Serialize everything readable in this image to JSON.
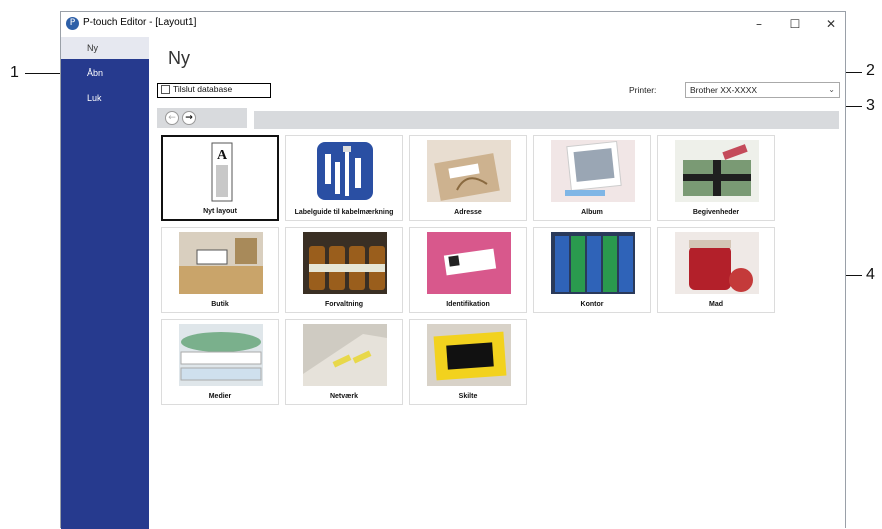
{
  "window": {
    "title": "P-touch Editor - [Layout1]",
    "controls": {
      "minimize": "–",
      "maximize": "☐",
      "close": "✕"
    }
  },
  "sidebar": {
    "items": [
      {
        "label": "Ny",
        "active": true
      },
      {
        "label": "Åbn",
        "active": false
      },
      {
        "label": "Luk",
        "active": false
      }
    ]
  },
  "main": {
    "title": "Ny",
    "connect_database_label": "Tilslut database",
    "connect_database_checked": false,
    "printer_label": "Printer:",
    "printer_value": "Brother XX-XXXX"
  },
  "nav": {
    "back": "←",
    "forward": "→"
  },
  "templates": [
    {
      "label": "Nyt layout",
      "selected": true
    },
    {
      "label": "Labelguide til kabelmærkning"
    },
    {
      "label": "Adresse"
    },
    {
      "label": "Album"
    },
    {
      "label": "Begivenheder"
    },
    {
      "label": "Butik"
    },
    {
      "label": "Forvaltning"
    },
    {
      "label": "Identifikation"
    },
    {
      "label": "Kontor"
    },
    {
      "label": "Mad"
    },
    {
      "label": "Medier"
    },
    {
      "label": "Netværk"
    },
    {
      "label": "Skilte"
    }
  ],
  "callouts": {
    "c1": "1",
    "c2": "2",
    "c3": "3",
    "c4": "4"
  },
  "colors": {
    "sidebar": "#263a8e",
    "sidebar_active": "#e6e8f0",
    "navbar": "#d8dadd"
  }
}
